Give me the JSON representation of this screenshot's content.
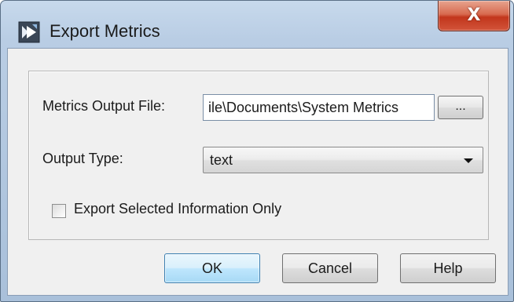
{
  "window": {
    "title": "Export Metrics",
    "icon": "export-metrics-app-icon",
    "close_glyph": "X"
  },
  "form": {
    "metrics_output_file_label": "Metrics Output File:",
    "metrics_output_file_value": "ile\\Documents\\System Metrics",
    "browse_label": "...",
    "output_type_label": "Output Type:",
    "output_type_value": "text",
    "export_selected_label": "Export Selected Information Only",
    "export_selected_checked": false
  },
  "buttons": {
    "ok_label": "OK",
    "cancel_label": "Cancel",
    "help_label": "Help"
  },
  "colors": {
    "title_bar": "#b9cde4",
    "close_button": "#c2361c",
    "default_button_border": "#3c7fb1"
  }
}
